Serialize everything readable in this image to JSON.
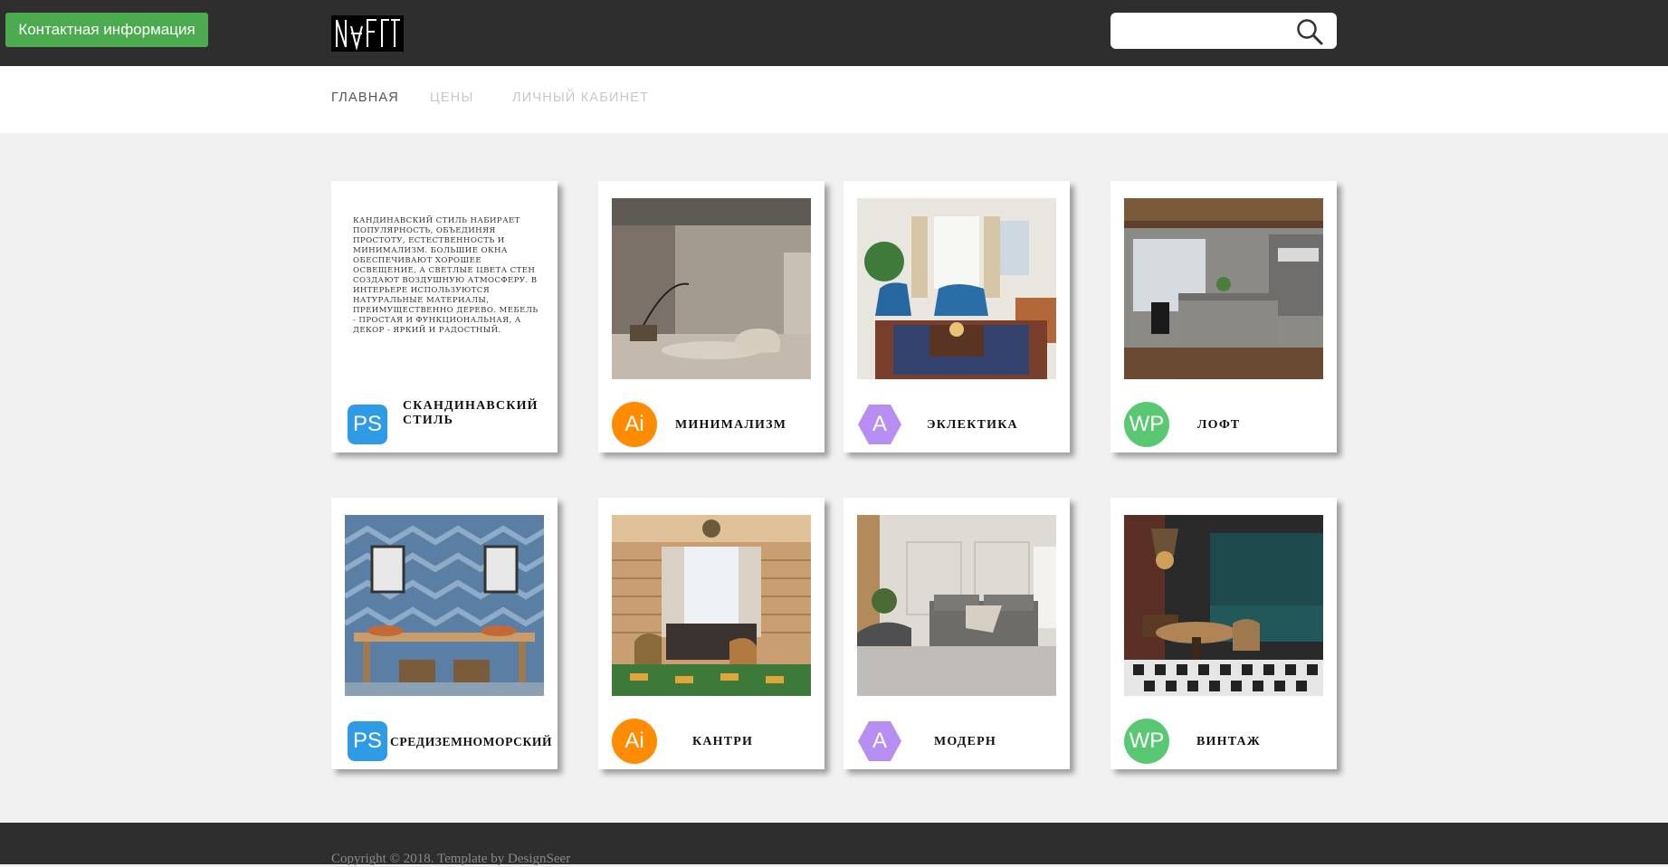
{
  "header": {
    "contact_label": "Контактная информация",
    "search_placeholder": ""
  },
  "nav": {
    "items": [
      {
        "label": "ГЛАВНАЯ"
      },
      {
        "label": "ЦЕНЫ"
      },
      {
        "label": "ЛИЧНЫЙ КАБИНЕТ"
      }
    ]
  },
  "cards": [
    {
      "title": "СКАНДИНАВСКИЙ СТИЛЬ",
      "badge": "PS",
      "color": "#2f9be6",
      "description": "кандинавский стиль набирает популярность, объединяя простоту, естественность и минимализм. Большие окна обеспечивают хорошее освещение, а светлые цвета стен создают воздушную атмосферу. В интерьере используются натуральные материалы, преимущественно дерево. Мебель - простая и функциональная, а декор - яркий и радостный."
    },
    {
      "title": "МИНИМАЛИЗМ",
      "badge": "Ai",
      "color": "#ff8c00"
    },
    {
      "title": "ЭКЛЕКТИКА",
      "badge": "A",
      "color": "#b78ef2"
    },
    {
      "title": "ЛОФТ",
      "badge": "WP",
      "color": "#5ac873"
    },
    {
      "title": "СРЕДИЗЕМНОМОРСКИЙ",
      "badge": "PS",
      "color": "#2f9be6"
    },
    {
      "title": "КАНТРИ",
      "badge": "Ai",
      "color": "#ff8c00"
    },
    {
      "title": "МОДЕРН",
      "badge": "A",
      "color": "#b78ef2"
    },
    {
      "title": "ВИНТАЖ",
      "badge": "WP",
      "color": "#5ac873"
    }
  ],
  "footer": {
    "copyright": "Copyright © 2018. Template by DesignSeer"
  },
  "colors": {
    "topbar": "#2f2e2f",
    "contact_button": "#4caa4f",
    "page_background": "#f1f1f1"
  }
}
